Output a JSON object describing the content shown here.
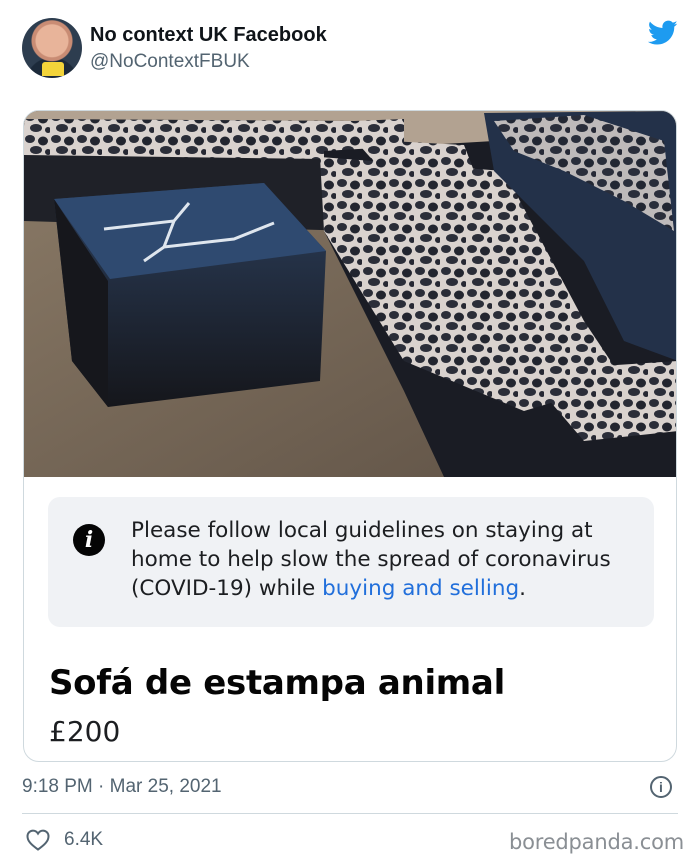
{
  "tweet": {
    "user_name": "No context UK Facebook",
    "user_handle": "@NoContextFBUK",
    "timestamp": "9:18 PM · Mar 25, 2021",
    "like_count": "6.4K"
  },
  "listing": {
    "notice_text_before": "Please follow local guidelines on staying at home to help slow the spread of coronavirus (COVID-19) while ",
    "notice_link": "buying and selling",
    "notice_text_after": ".",
    "title": "Sofá de estampa animal",
    "price": "£200"
  },
  "watermark": "boredpanda.com",
  "colors": {
    "twitter_blue": "#1d9bf0",
    "link_blue": "#216fdb",
    "muted_text": "#536471",
    "notice_background": "#f0f2f5"
  },
  "icons": {
    "logo": "twitter-bird-icon",
    "notice": "info-icon",
    "timestamp_info": "info-circle-icon",
    "likes": "heart-icon"
  }
}
